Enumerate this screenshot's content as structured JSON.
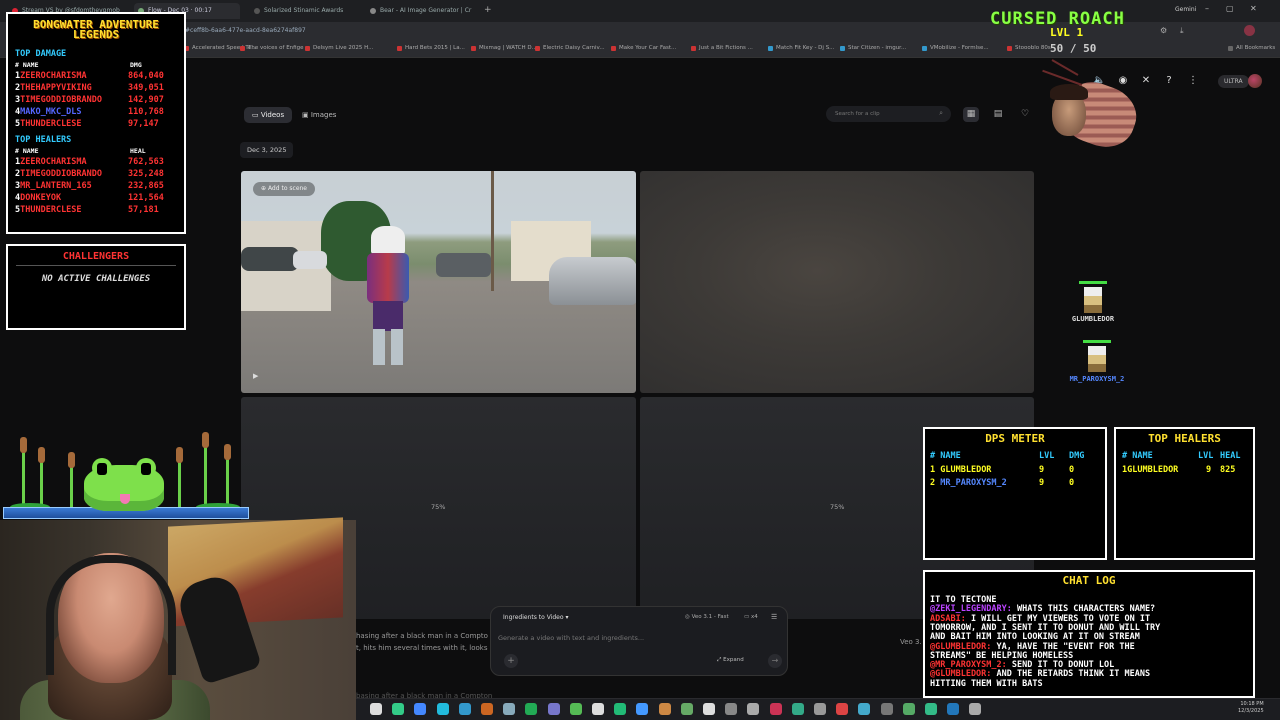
{
  "browser": {
    "tabs": [
      {
        "title": "Stream VS by @sfdomthevgmob",
        "fav": "#d23"
      },
      {
        "title": "Flow - Dec 03 · 00:17",
        "fav": "#7a7"
      },
      {
        "title": "Solarized Stinamic Awards",
        "fav": "#555"
      },
      {
        "title": "Bear - AI Image Generator | Cr",
        "fav": "#888"
      }
    ],
    "gemini_label": "Gemini",
    "url_fragment": "#ceff8b-6aa6-477e-aacd-8ea6274af897",
    "bookmarks": [
      {
        "label": "Accelerated Speed Te...",
        "fav": "#c33"
      },
      {
        "label": "The voices of Enfige ...",
        "fav": "#c33"
      },
      {
        "label": "Delsym Live 2025 H...",
        "fav": "#c33"
      },
      {
        "label": "Hard Bets 2015 | La...",
        "fav": "#c33"
      },
      {
        "label": "Mixmag | WATCH D...",
        "fav": "#c33"
      },
      {
        "label": "Electric Daisy Carniv...",
        "fav": "#c33"
      },
      {
        "label": "Make Your Car Fast...",
        "fav": "#c33"
      },
      {
        "label": "Just a Bit Fictions ...",
        "fav": "#c33"
      },
      {
        "label": "Match Fit Key - Dj S...",
        "fav": "#39c"
      },
      {
        "label": "Star Citizen - imgur...",
        "fav": "#39c"
      },
      {
        "label": "VMobilize - Formlse...",
        "fav": "#39c"
      },
      {
        "label": "Stoooblo 80s",
        "fav": "#c33"
      },
      {
        "label": "All Bookmarks",
        "fav": "#666"
      }
    ]
  },
  "app": {
    "filters": [
      {
        "label": "Videos",
        "icon": "video-icon"
      },
      {
        "label": "Images",
        "icon": "image-icon"
      }
    ],
    "search_placeholder": "Search for a clip",
    "ultra_badge": "ULTRA",
    "date_chip": "Dec 3, 2025",
    "add_to_scene": "Add to scene",
    "tile_progress": [
      "75%",
      "75%"
    ],
    "prompt": {
      "mode": "Ingredients to Video",
      "model": "Veo 3.1 - Fast",
      "count": "x4",
      "placeholder": "Generate a video with text and ingredients...",
      "expand": "Expand"
    },
    "background_texts": {
      "line1": "hasing after a black man in a Compto",
      "line2": "t, hits him several times with it, looks",
      "veo": "Veo 3.",
      "line3": "basing after a black man in a Compton"
    }
  },
  "legends": {
    "title": "BONGWATER ADVENTURE LEGENDS",
    "top_damage": {
      "heading": "TOP DAMAGE",
      "col_name": "# NAME",
      "col_value": "DMG",
      "rows": [
        {
          "rank": "1",
          "name": "ZEEROCHARISMA",
          "value": "864,040",
          "style": "red"
        },
        {
          "rank": "2",
          "name": "THEHAPPYVIKING",
          "value": "349,051",
          "style": "red"
        },
        {
          "rank": "3",
          "name": "TIMEGODDIOBRANDO",
          "value": "142,907",
          "style": "red"
        },
        {
          "rank": "4",
          "name": "MAKO_MKC_DLS",
          "value": "110,768",
          "style": "blue"
        },
        {
          "rank": "5",
          "name": "THUNDERCLESE",
          "value": "97,147",
          "style": "red"
        }
      ]
    },
    "top_healers": {
      "heading": "TOP HEALERS",
      "col_name": "# NAME",
      "col_value": "HEAL",
      "rows": [
        {
          "rank": "1",
          "name": "ZEEROCHARISMA",
          "value": "762,563",
          "style": "red"
        },
        {
          "rank": "2",
          "name": "TIMEGODDIOBRANDO",
          "value": "325,248",
          "style": "red"
        },
        {
          "rank": "3",
          "name": "MR_LANTERN_165",
          "value": "232,865",
          "style": "red"
        },
        {
          "rank": "4",
          "name": "DONKEYOK",
          "value": "121,564",
          "style": "red"
        },
        {
          "rank": "5",
          "name": "THUNDERCLESE",
          "value": "57,181",
          "style": "red"
        }
      ]
    }
  },
  "challengers": {
    "title": "CHALLENGERS",
    "empty": "NO ACTIVE CHALLENGES"
  },
  "boss": {
    "name": "CURSED ROACH",
    "level": "LVL 1",
    "hp": "50 / 50"
  },
  "minions": [
    {
      "name": "GLUMBLEDOR"
    },
    {
      "name": "MR_PAROXYSM_2"
    }
  ],
  "dps_meter": {
    "title": "DPS METER",
    "headers": {
      "name": "# NAME",
      "lvl": "LVL",
      "dmg": "DMG"
    },
    "rows": [
      {
        "rank": "1",
        "name": "GLUMBLEDOR",
        "lvl": "9",
        "dmg": "0",
        "style": "yellow"
      },
      {
        "rank": "2",
        "name": "MR_PAROXYSM_2",
        "lvl": "9",
        "dmg": "0",
        "style": "blue"
      }
    ]
  },
  "top_healers_panel": {
    "title": "TOP HEALERS",
    "headers": {
      "name": "# NAME",
      "lvl": "LVL",
      "heal": "HEAL"
    },
    "rows": [
      {
        "rank": "1",
        "name": "GLUMBLEDOR",
        "lvl": "9",
        "heal": "825"
      }
    ]
  },
  "chat_log": {
    "title": "CHAT LOG",
    "lines": [
      {
        "user": "",
        "text": "IT TO TECTONE"
      },
      {
        "user": "@ZEKI_LEGENDARY:",
        "text": " WHATS THIS CHARACTERS NAME?",
        "color": "purple"
      },
      {
        "user": "ADSABI:",
        "text": " I WILL GET MY VIEWERS TO VOTE ON IT"
      },
      {
        "user": "",
        "text": "TOMORROW, AND I SENT IT TO DONUT AND WILL TRY"
      },
      {
        "user": "",
        "text": "AND BAIT HIM INTO LOOKING AT IT ON STREAM"
      },
      {
        "user": "@GLUMBLEDOR:",
        "text": " YA, HAVE THE \"EVENT FOR THE"
      },
      {
        "user": "",
        "text": "STREAMS\" BE HELPING HOMELESS"
      },
      {
        "user": "@MR_PAROXYSM_2:",
        "text": " SEND IT TO DONUT LOL"
      },
      {
        "user": "@GLUMBLEDOR:",
        "text": " AND THE RETARDS THINK IT MEANS"
      },
      {
        "user": "",
        "text": "HITTING THEM WITH BATS"
      }
    ]
  },
  "taskbar": {
    "clock_time": "10:18 PM",
    "clock_date": "12/3/2025"
  }
}
